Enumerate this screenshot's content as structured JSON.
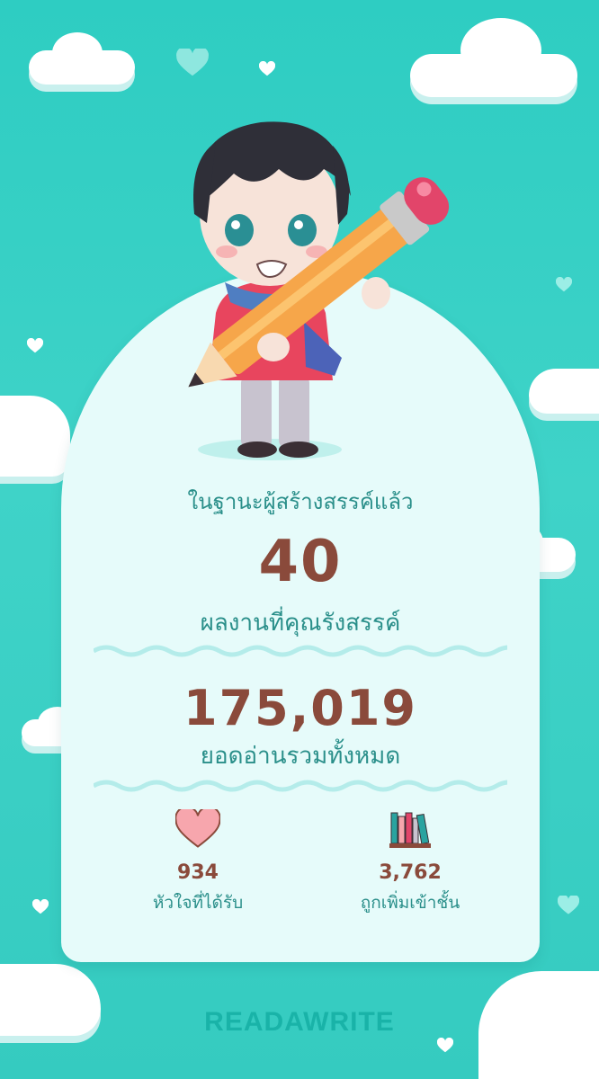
{
  "summary": {
    "caption": "ในฐานะผู้สร้างสรรค์แล้ว",
    "works_count": "40",
    "works_label": "ผลงานที่คุณรังสรรค์",
    "reads_total": "175,019",
    "reads_label": "ยอดอ่านรวมทั้งหมด"
  },
  "stats": {
    "hearts_value": "934",
    "hearts_label": "หัวใจที่ได้รับ",
    "shelf_value": "3,762",
    "shelf_label": "ถูกเพิ่มเข้าชั้น"
  },
  "brand": {
    "name": "READAWRITE"
  },
  "icons": [
    "heart-icon",
    "bookshelf-icon",
    "pencil-mascot-illustration",
    "cloud",
    "small-heart"
  ],
  "colors": {
    "background": "#35cbc0",
    "card": "#e6fbfa",
    "number": "#8a4a3b",
    "label": "#2a8f8a",
    "brand": "#19b3a8",
    "heart": "#f7a6ad"
  }
}
